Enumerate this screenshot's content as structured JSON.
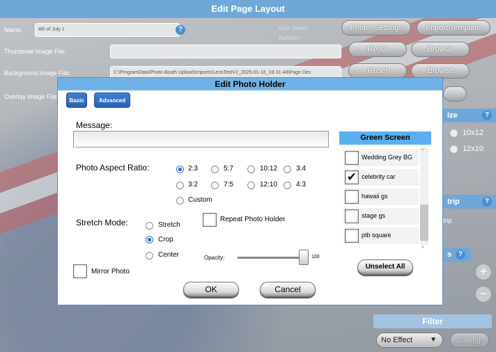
{
  "window": {
    "title": "Edit Page Layout",
    "name_label": "Name:",
    "name_value": "4th of July 1",
    "thumb_label": "Thumbnail Image File:",
    "thumb_value": "",
    "background_label": "Background Image File:",
    "background_value": "C:\\ProgramData\\Photo Booth Upload\\Imports\\LensTestV2_2025-01-16_18-31-48\\Page Des",
    "overlay_label": "Overlay Image File",
    "user_select_label": "User Select",
    "random_label": "Random",
    "printer_settings": "Printer Settings",
    "import_template": "Import Template",
    "reset": "Reset",
    "browse": "Browse",
    "size_panel_suffix": "ize",
    "size_10x12": "10x12",
    "size_12x10": "12x10",
    "strip_panel_suffix": "trip",
    "strip_text": "trip",
    "s_panel_suffix": "s",
    "plus": "+",
    "minus": "−",
    "filter_title": "Filter",
    "filter_value": "No Effect",
    "config": "Config"
  },
  "dialog": {
    "title": "Edit Photo Holder",
    "tabs": [
      "Basic",
      "Advanced"
    ],
    "message_label": "Message:",
    "message_value": "",
    "aspect_label": "Photo Aspect Ratio:",
    "aspect_options": [
      "2:3",
      "5:7",
      "10:12",
      "3:4",
      "3:2",
      "7:5",
      "12:10",
      "4:3",
      "Custom"
    ],
    "aspect_selected": "2:3",
    "stretch_label": "Stretch Mode:",
    "stretch_options": [
      "Stretch",
      "Crop",
      "Center"
    ],
    "stretch_selected": "Crop",
    "repeat_label": "Repeat Photo Holder",
    "mirror_label": "Mirror Photo",
    "opacity_label": "Opacity:",
    "opacity_value": "100",
    "ok": "OK",
    "cancel": "Cancel",
    "green_screen": {
      "title": "Green Screen",
      "items": [
        {
          "label": "Wedding Grey BG",
          "checked": false
        },
        {
          "label": "celebrity car",
          "checked": true
        },
        {
          "label": "hawaii gs",
          "checked": false
        },
        {
          "label": "stage gs",
          "checked": false
        },
        {
          "label": "ptb square",
          "checked": false
        }
      ],
      "unselect_all": "Unselect All"
    }
  },
  "colors": {
    "accent": "#6fb3e6",
    "tab": "#2f6fd1"
  }
}
